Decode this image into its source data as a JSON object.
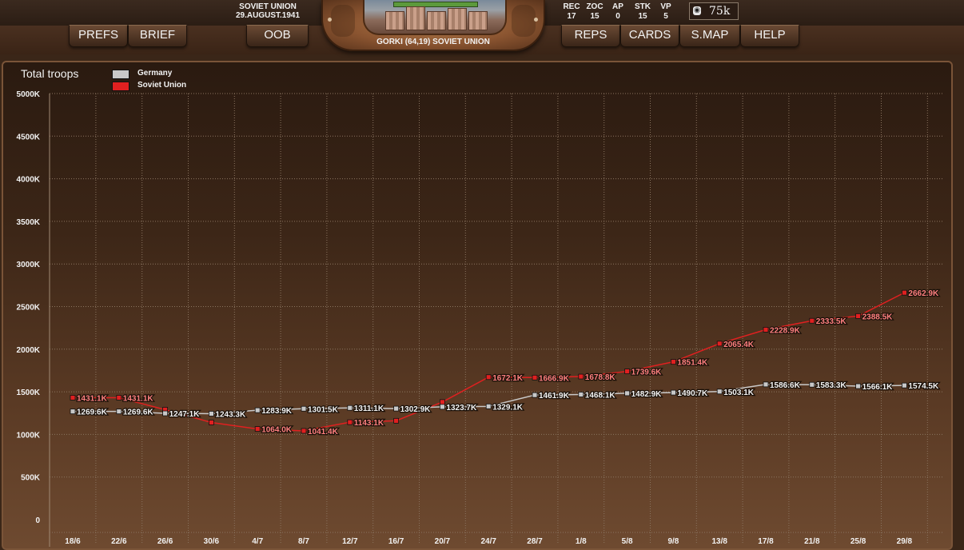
{
  "header": {
    "nation": "SOVIET UNION",
    "date": "29.AUGUST.1941",
    "location": "GORKI (64,19) SOVIET UNION",
    "stats": [
      {
        "label": "REC",
        "value": "17"
      },
      {
        "label": "ZOC",
        "value": "15"
      },
      {
        "label": "AP",
        "value": "0"
      },
      {
        "label": "STK",
        "value": "15"
      },
      {
        "label": "VP",
        "value": "5"
      }
    ],
    "money": "75k"
  },
  "nav": {
    "prefs": "PREFS",
    "brief": "BRIEF",
    "oob": "OOB",
    "reps": "REPS",
    "cards": "CARDS",
    "smap": "S.MAP",
    "help": "HELP"
  },
  "colors": {
    "germany": "#c8c8c8",
    "soviet": "#e02020",
    "grid": "#8a7460"
  },
  "chart_data": {
    "type": "line",
    "title": "Total troops",
    "xlabel": "",
    "ylabel": "",
    "ylim": [
      0,
      5000
    ],
    "yticks": [
      0,
      500,
      1000,
      1500,
      2000,
      2500,
      3000,
      3500,
      4000,
      4500,
      5000
    ],
    "ytick_labels": [
      "0",
      "500K",
      "1000K",
      "1500K",
      "2000K",
      "2500K",
      "3000K",
      "3500K",
      "4000K",
      "4500K",
      "5000K"
    ],
    "categories": [
      "18/6",
      "22/6",
      "26/6",
      "30/6",
      "4/7",
      "8/7",
      "12/7",
      "16/7",
      "20/7",
      "24/7",
      "28/7",
      "1/8",
      "5/8",
      "9/8",
      "13/8",
      "17/8",
      "21/8",
      "25/8",
      "29/8"
    ],
    "legend_position": "top-left",
    "grid": true,
    "series": [
      {
        "name": "Germany",
        "color": "#c8c8c8",
        "x": [
          0,
          1,
          2,
          3,
          4,
          5,
          6,
          7,
          8,
          9,
          10,
          11,
          12,
          13,
          14,
          15,
          16,
          17,
          18
        ],
        "values": [
          1269.6,
          1269.6,
          1247.1,
          1243.3,
          1283.9,
          1301.5,
          1311.1,
          1302.9,
          1323.7,
          1329.1,
          1461.9,
          1468.1,
          1482.9,
          1490.7,
          1503.1,
          1586.6,
          1583.3,
          1566.1,
          1574.5
        ],
        "labels": [
          "1269.6K",
          "1269.6K",
          "1247.1K",
          "1243.3K",
          "1283.9K",
          "1301.5K",
          "1311.1K",
          "1302.9K",
          "1323.7K",
          "1329.1K",
          "1461.9K",
          "1468.1K",
          "1482.9K",
          "1490.7K",
          "1503.1K",
          "1586.6K",
          "1583.3K",
          "1566.1K",
          "1574.5K"
        ]
      },
      {
        "name": "Soviet Union",
        "color": "#e02020",
        "x": [
          0,
          1,
          2,
          3,
          4,
          5,
          6,
          7,
          8,
          9,
          10,
          11,
          12,
          13,
          14,
          15,
          16,
          17,
          18
        ],
        "values": [
          1431.1,
          1431.1,
          1290.0,
          1140.0,
          1064.0,
          1041.4,
          1143.1,
          1160.0,
          1380.0,
          1672.1,
          1666.9,
          1678.8,
          1739.6,
          1851.4,
          2065.4,
          2228.9,
          2333.5,
          2388.5,
          2662.9
        ],
        "labels": [
          "1431.1K",
          "1431.1K",
          "",
          "",
          "1064.0K",
          "1041.4K",
          "1143.1K",
          "",
          "",
          "1672.1K",
          "1666.9K",
          "1678.8K",
          "1739.6K",
          "1851.4K",
          "2065.4K",
          "2228.9K",
          "2333.5K",
          "2388.5K",
          "2662.9K"
        ]
      }
    ]
  }
}
